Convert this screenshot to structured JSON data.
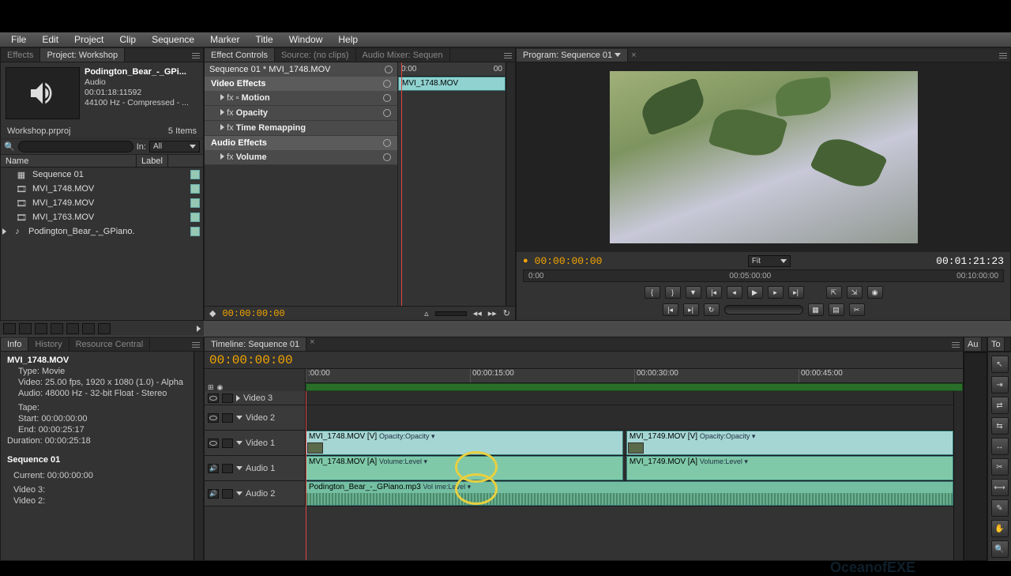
{
  "menu": [
    "File",
    "Edit",
    "Project",
    "Clip",
    "Sequence",
    "Marker",
    "Title",
    "Window",
    "Help"
  ],
  "project": {
    "tab_effects": "Effects",
    "tab_project": "Project: Workshop",
    "preview": {
      "name": "Podington_Bear_-_GPi...",
      "type": "Audio",
      "duration": "00:01:18:11592",
      "format": "44100 Hz - Compressed - ..."
    },
    "filename": "Workshop.prproj",
    "item_count": "5 Items",
    "in_label": "In:",
    "in_value": "All",
    "columns": {
      "name": "Name",
      "label": "Label"
    },
    "bins": [
      {
        "icon": "seq",
        "name": "Sequence 01"
      },
      {
        "icon": "mov",
        "name": "MVI_1748.MOV"
      },
      {
        "icon": "mov",
        "name": "MVI_1749.MOV"
      },
      {
        "icon": "mov",
        "name": "MVI_1763.MOV"
      },
      {
        "icon": "aud",
        "name": "Podington_Bear_-_GPiano."
      }
    ]
  },
  "effect_controls": {
    "tab_ec": "Effect Controls",
    "tab_source": "Source: (no clips)",
    "tab_mixer": "Audio Mixer: Sequen",
    "breadcrumb": "Sequence 01 * MVI_1748.MOV",
    "video_effects": "Video Effects",
    "audio_effects": "Audio Effects",
    "fx": {
      "motion": "Motion",
      "opacity": "Opacity",
      "time_remap": "Time Remapping",
      "volume": "Volume"
    },
    "clipbar": "MVI_1748.MOV",
    "ruler_start": "0:00",
    "ruler_end": "00",
    "timecode": "00:00:00:00"
  },
  "program": {
    "title": "Program: Sequence 01",
    "tc_left": "00:00:00:00",
    "tc_right": "00:01:21:23",
    "fit": "Fit",
    "ruler": [
      "0:00",
      "00:05:00:00",
      "00:10:00:00"
    ]
  },
  "info": {
    "tab_info": "Info",
    "tab_history": "History",
    "tab_rc": "Resource Central",
    "name": "MVI_1748.MOV",
    "type": "Type: Movie",
    "video": "Video: 25.00 fps, 1920 x 1080 (1.0) - Alpha",
    "audio": "Audio: 48000 Hz - 32-bit Float - Stereo",
    "tape": "Tape:",
    "start": "Start: 00:00:00:00",
    "end": "End: 00:00:25:17",
    "duration": "Duration: 00:00:25:18",
    "seq_name": "Sequence 01",
    "current": "Current: 00:00:00:00",
    "v3": "Video 3:",
    "v2": "Video 2:"
  },
  "timeline": {
    "tab": "Timeline: Sequence 01",
    "tc": "00:00:00:00",
    "ruler": [
      ":00:00",
      "00:00:15:00",
      "00:00:30:00",
      "00:00:45:00"
    ],
    "tracks": {
      "v3": "Video 3",
      "v2": "Video 2",
      "v1": "Video 1",
      "a1": "Audio 1",
      "a2": "Audio 2"
    },
    "clips": {
      "v1a": "MVI_1748.MOV [V]",
      "v1a_sub": "Opacity:Opacity ▾",
      "v1b": "MVI_1749.MOV [V]",
      "v1b_sub": "Opacity:Opacity ▾",
      "a1a": "MVI_1748.MOV [A]",
      "a1a_sub": "Volume:Level ▾",
      "a1b": "MVI_1749.MOV [A]",
      "a1b_sub": "Volume:Level ▾",
      "a2": "Podington_Bear_-_GPiano.mp3",
      "a2_sub": "Vol ime:Level ▾"
    }
  },
  "side": {
    "au_tab": "Au",
    "to_tab": "To"
  }
}
